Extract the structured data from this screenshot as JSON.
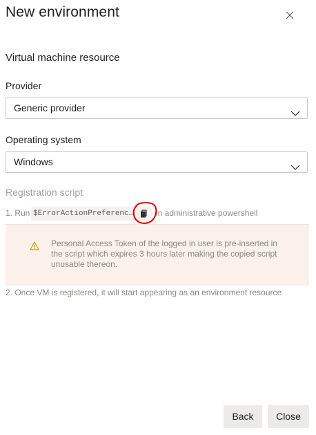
{
  "header": {
    "title": "New environment"
  },
  "section": {
    "title": "Virtual machine resource"
  },
  "provider": {
    "label": "Provider",
    "value": "Generic provider"
  },
  "os": {
    "label": "Operating system",
    "value": "Windows"
  },
  "registration": {
    "label": "Registration script",
    "step1_prefix": "1. Run",
    "code_snippet": "$ErrorActionPreferenc…",
    "step1_suffix": "in administrative powershell",
    "warning": "Personal Access Token of the logged in user is pre-inserted in the script which expires 3 hours later making the copied script unusable thereon.",
    "step2": "2. Once VM is registered, it will start appearing as an environment resource"
  },
  "footer": {
    "back_label": "Back",
    "close_label": "Close"
  },
  "colors": {
    "warning_background": "#fbf0ea",
    "warning_icon": "#c19c00",
    "annotation_circle": "#e00000"
  },
  "icons": {
    "dismiss": "close-icon",
    "dropdown": "chevron-down-icon",
    "copy": "copy-icon",
    "warning": "warning-icon"
  }
}
